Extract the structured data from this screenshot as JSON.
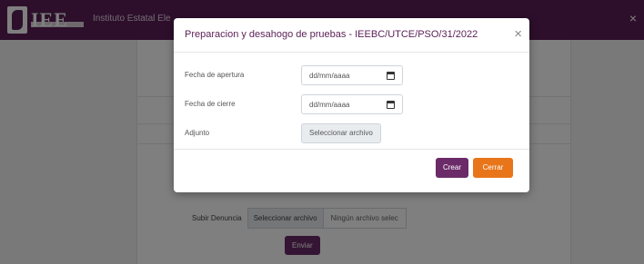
{
  "navbar": {
    "logo_text": "IEE",
    "title": "Instituto Estatal Ele",
    "close_label": "×"
  },
  "background": {
    "file_label": "Subir Denuncia",
    "file_button": "Seleccionar archivo",
    "file_status": "Ningún archivo selec",
    "submit_label": "Enviar"
  },
  "modal": {
    "title": "Preparacion y desahogo de pruebas - IEEBC/UTCE/PSO/31/2022",
    "close_label": "×",
    "fields": {
      "opening_date": {
        "label": "Fecha de apertura",
        "placeholder": "dd/mm/aaaa"
      },
      "closing_date": {
        "label": "Fecha de cierre",
        "placeholder": "dd/mm/aaaa"
      },
      "attachment": {
        "label": "Adjunto",
        "button": "Seleccionar archivo"
      }
    },
    "buttons": {
      "create": "Crear",
      "close": "Cerrar"
    }
  },
  "colors": {
    "brand": "#5b1f57",
    "primary_button": "#6b2a68",
    "close_button": "#e8751a"
  }
}
